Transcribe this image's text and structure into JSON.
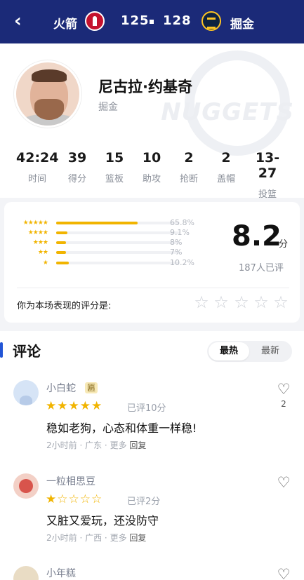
{
  "header": {
    "back_label": "‹",
    "team_left": "火箭",
    "score_left": "125",
    "score_right": "128",
    "team_right": "掘金",
    "bg_color": "#1b2a78"
  },
  "player": {
    "name": "尼古拉·约基奇",
    "team": "掘金",
    "watermark": "NUGGETS"
  },
  "stats": [
    {
      "value": "42:24",
      "label": "时间"
    },
    {
      "value": "39",
      "label": "得分"
    },
    {
      "value": "15",
      "label": "篮板"
    },
    {
      "value": "10",
      "label": "助攻"
    },
    {
      "value": "2",
      "label": "抢断"
    },
    {
      "value": "2",
      "label": "盖帽"
    },
    {
      "value": "13-27",
      "label": "投篮"
    }
  ],
  "rating": {
    "distribution": [
      {
        "stars": "★★★★★",
        "percent": "65.8%",
        "fraction": 0.658
      },
      {
        "stars": "★★★★",
        "percent": "9.1%",
        "fraction": 0.091
      },
      {
        "stars": "★★★",
        "percent": "8%",
        "fraction": 0.08
      },
      {
        "stars": "★★",
        "percent": "7%",
        "fraction": 0.07
      },
      {
        "stars": "★",
        "percent": "10.2%",
        "fraction": 0.102
      }
    ],
    "score": "8.2",
    "score_unit": "分",
    "rated_count": "187人已评",
    "prompt": "你为本场表现的评分是:",
    "accent_color": "#f1b400"
  },
  "comments_section": {
    "title": "评论",
    "sort_hot": "最热",
    "sort_new": "最新",
    "active_sort": "最热"
  },
  "comments": [
    {
      "name": "小白蛇",
      "badge": "匾",
      "stars_filled": 5,
      "rated": "已评10分",
      "text": "稳如老狗，心态和体重一样稳!",
      "time": "2小时前",
      "location": "广东",
      "more": "更多",
      "reply": "回复",
      "likes": "2"
    },
    {
      "name": "一粒相思豆",
      "stars_filled": 1,
      "rated": "已评2分",
      "text": "又脏又爱玩，还没防守",
      "time": "2小时前",
      "location": "广西",
      "more": "更多",
      "reply": "回复"
    },
    {
      "name": "小年糕"
    }
  ]
}
